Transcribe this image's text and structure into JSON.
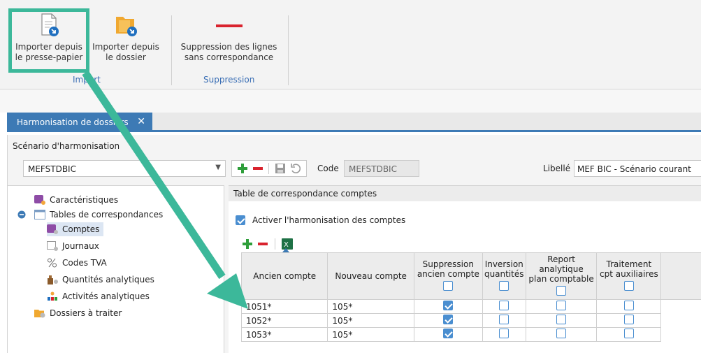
{
  "ribbon": {
    "groups": [
      {
        "label": "Import",
        "buttons": [
          {
            "label_line1": "Importer depuis",
            "label_line2": "le presse-papier",
            "icon": "clipboard-import-icon"
          },
          {
            "label_line1": "Importer depuis",
            "label_line2": "le dossier",
            "icon": "folder-import-icon"
          }
        ]
      },
      {
        "label": "Suppression",
        "buttons": [
          {
            "label_line1": "Suppression des lignes",
            "label_line2": "sans correspondance",
            "icon": "red-minus-icon"
          }
        ]
      }
    ]
  },
  "tab": {
    "label": "Harmonisation de dossiers",
    "close": "✕"
  },
  "scenario": {
    "label": "Scénario d'harmonisation",
    "selected": "MEFSTDBIC",
    "code_label": "Code",
    "code_value": "MEFSTDBIC",
    "libelle_label": "Libellé",
    "libelle_value": "MEF BIC - Scénario courant"
  },
  "tree": {
    "items": [
      {
        "label": "Caractéristiques",
        "icon": "badge-icon"
      },
      {
        "label": "Tables de correspondances",
        "icon": "table-icon"
      },
      {
        "label": "Comptes",
        "icon": "badge-icon"
      },
      {
        "label": "Journaux",
        "icon": "journal-icon"
      },
      {
        "label": "Codes TVA",
        "icon": "percent-icon"
      },
      {
        "label": "Quantités analytiques",
        "icon": "weight-icon"
      },
      {
        "label": "Activités analytiques",
        "icon": "activity-icon"
      },
      {
        "label": "Dossiers à traiter",
        "icon": "folder-icon"
      }
    ]
  },
  "content": {
    "title": "Table de correspondance comptes",
    "activate_label": "Activer l'harmonisation des comptes",
    "activate_checked": true
  },
  "grid": {
    "headers": [
      {
        "l1": "",
        "l2": "",
        "l3": "Ancien compte"
      },
      {
        "l1": "",
        "l2": "",
        "l3": "Nouveau compte"
      },
      {
        "l1": "",
        "l2": "Suppression",
        "l3": "ancien compte"
      },
      {
        "l1": "",
        "l2": "Inversion",
        "l3": "quantités"
      },
      {
        "l1": "Report",
        "l2": "analytique",
        "l3": "plan comptable"
      },
      {
        "l1": "",
        "l2": "Traitement",
        "l3": "cpt auxiliaires"
      }
    ],
    "rows": [
      {
        "ancien": "1051*",
        "nouveau": "105*",
        "suppression": true,
        "inversion": false,
        "report": false,
        "traitement": false
      },
      {
        "ancien": "1052*",
        "nouveau": "105*",
        "suppression": true,
        "inversion": false,
        "report": false,
        "traitement": false
      },
      {
        "ancien": "1053*",
        "nouveau": "105*",
        "suppression": true,
        "inversion": false,
        "report": false,
        "traitement": false
      }
    ]
  },
  "colors": {
    "accent": "#3d7ab5",
    "highlight": "#3cb89a",
    "minus": "#d9232e",
    "plus": "#2e9e3a",
    "check": "#4a8ed0"
  }
}
